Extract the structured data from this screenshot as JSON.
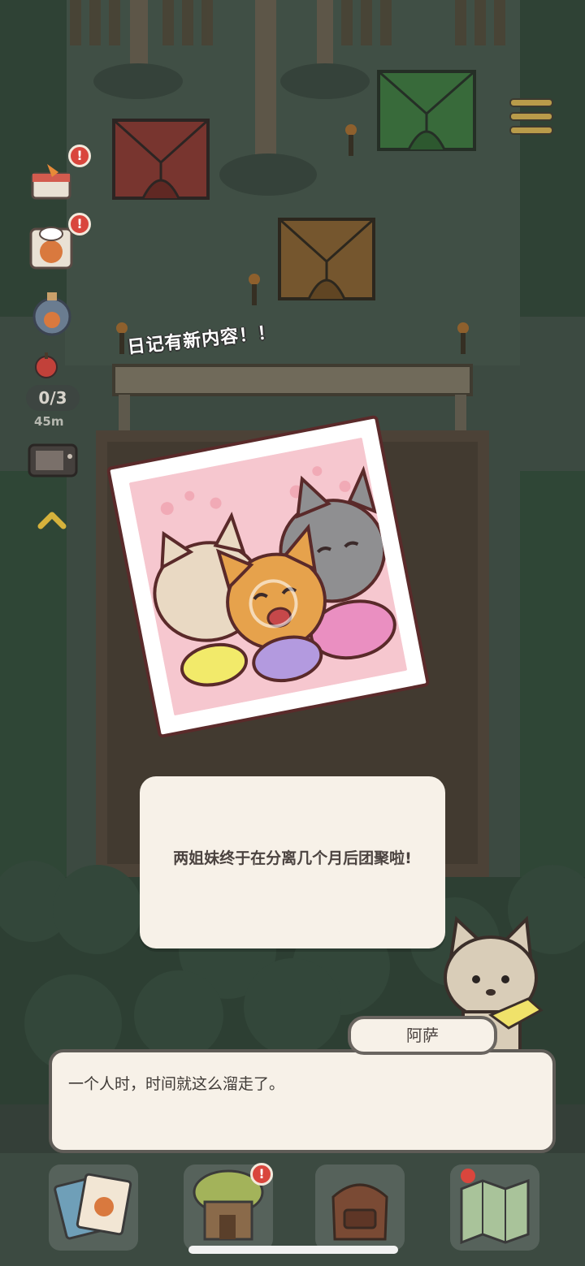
{
  "hud": {
    "food_truck_icon": "shop-truck-icon",
    "chef_icon": "chef-cat-icon",
    "bottle_icon": "bottle-icon",
    "catch_counter": "0/3",
    "distance": "45m",
    "tv_icon": "tv-icon",
    "expand_icon": "chevron-up-icon",
    "menu_icon": "hamburger-menu-icon",
    "alert_glyph": "!"
  },
  "notice": {
    "text": "日记有新内容！！"
  },
  "photo": {
    "description_icon": "three-cats-photo-icon"
  },
  "caption": {
    "text": "两姐妹终于在分离几个月后团聚啦!"
  },
  "dialogue": {
    "speaker": "阿萨",
    "text": "一个人时，时间就这么溜走了。"
  },
  "dock": {
    "items": [
      {
        "icon": "photo-album-icon"
      },
      {
        "icon": "tree-house-icon"
      },
      {
        "icon": "backpack-icon"
      },
      {
        "icon": "map-icon"
      }
    ]
  },
  "colors": {
    "tent_red": "#b5443e",
    "tent_green": "#4e9a4f",
    "tent_orange": "#b07a3c",
    "alert": "#d9463d",
    "panel": "#f7f1e8"
  }
}
